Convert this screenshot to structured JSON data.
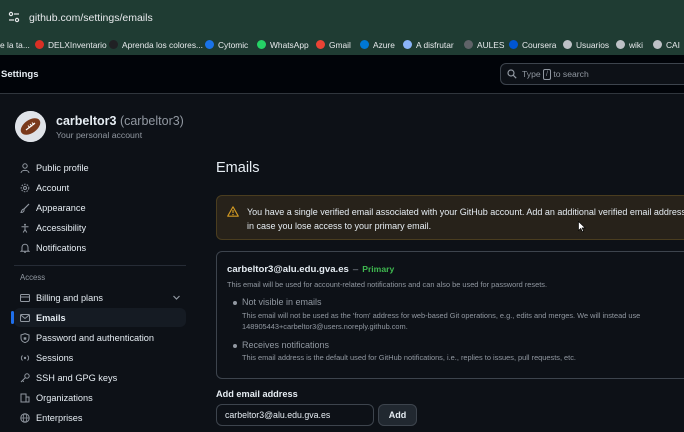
{
  "browser": {
    "url": "github.com/settings/emails",
    "bookmarks": [
      {
        "label": "e la ta...",
        "icon": "folder-icon",
        "color": "#e8eaed"
      },
      {
        "label": "DELXInventario",
        "icon": "delx-icon",
        "color": "#d93025"
      },
      {
        "label": "Aprenda los colores...",
        "icon": "ia-icon",
        "color": "#202124"
      },
      {
        "label": "Cytomic",
        "icon": "cytomic-icon",
        "color": "#1a73e8"
      },
      {
        "label": "WhatsApp",
        "icon": "whatsapp-icon",
        "color": "#25d366"
      },
      {
        "label": "Gmail",
        "icon": "gmail-icon",
        "color": "#ea4335"
      },
      {
        "label": "Azure",
        "icon": "azure-icon",
        "color": "#0078d4"
      },
      {
        "label": "A disfrutar",
        "icon": "link-icon",
        "color": "#8ab4f8"
      },
      {
        "label": "AULES",
        "icon": "aules-icon",
        "color": "#5f6368"
      },
      {
        "label": "Coursera",
        "icon": "coursera-icon",
        "color": "#0056d2"
      },
      {
        "label": "Usuarios",
        "icon": "globe-icon",
        "color": "#bdc1c6"
      },
      {
        "label": "wiki",
        "icon": "globe-icon",
        "color": "#bdc1c6"
      },
      {
        "label": "CAI",
        "icon": "globe-icon",
        "color": "#bdc1c6"
      }
    ]
  },
  "header": {
    "title": "Settings",
    "search_prefix": "Type",
    "search_key": "/",
    "search_suffix": "to search"
  },
  "profile": {
    "name": "carbeltor3",
    "login": "(carbeltor3)",
    "subtitle": "Your personal account"
  },
  "sidebar": {
    "items": [
      {
        "label": "Public profile",
        "icon": "person-icon"
      },
      {
        "label": "Account",
        "icon": "gear-icon"
      },
      {
        "label": "Appearance",
        "icon": "paintbrush-icon"
      },
      {
        "label": "Accessibility",
        "icon": "accessibility-icon"
      },
      {
        "label": "Notifications",
        "icon": "bell-icon"
      }
    ],
    "access_label": "Access",
    "access_items": [
      {
        "label": "Billing and plans",
        "icon": "credit-card-icon"
      },
      {
        "label": "Emails",
        "icon": "mail-icon"
      },
      {
        "label": "Password and authentication",
        "icon": "shield-lock-icon"
      },
      {
        "label": "Sessions",
        "icon": "broadcast-icon"
      },
      {
        "label": "SSH and GPG keys",
        "icon": "key-icon"
      },
      {
        "label": "Organizations",
        "icon": "organization-icon"
      },
      {
        "label": "Enterprises",
        "icon": "globe-icon"
      }
    ]
  },
  "main": {
    "title": "Emails",
    "flash": "You have a single verified email associated with your GitHub account. Add an additional verified email address in case you lose access to your primary email.",
    "email": {
      "address": "carbeltor3@alu.edu.gva.es",
      "separator": "–",
      "badge": "Primary",
      "description": "This email will be used for account-related notifications and can also be used for password resets.",
      "visibility_title": "Not visible in emails",
      "visibility_desc_1": "This email will not be used as the 'from' address for web-based Git operations, e.g., edits and merges. We will instead use",
      "visibility_desc_2": "148905443+carbeltor3@users.noreply.github.com.",
      "notifications_title": "Receives notifications",
      "notifications_desc": "This email address is the default used for GitHub notifications, i.e., replies to issues, pull requests, etc."
    },
    "add_label": "Add email address",
    "add_value": "carbeltor3@alu.edu.gva.es",
    "add_button": "Add"
  }
}
